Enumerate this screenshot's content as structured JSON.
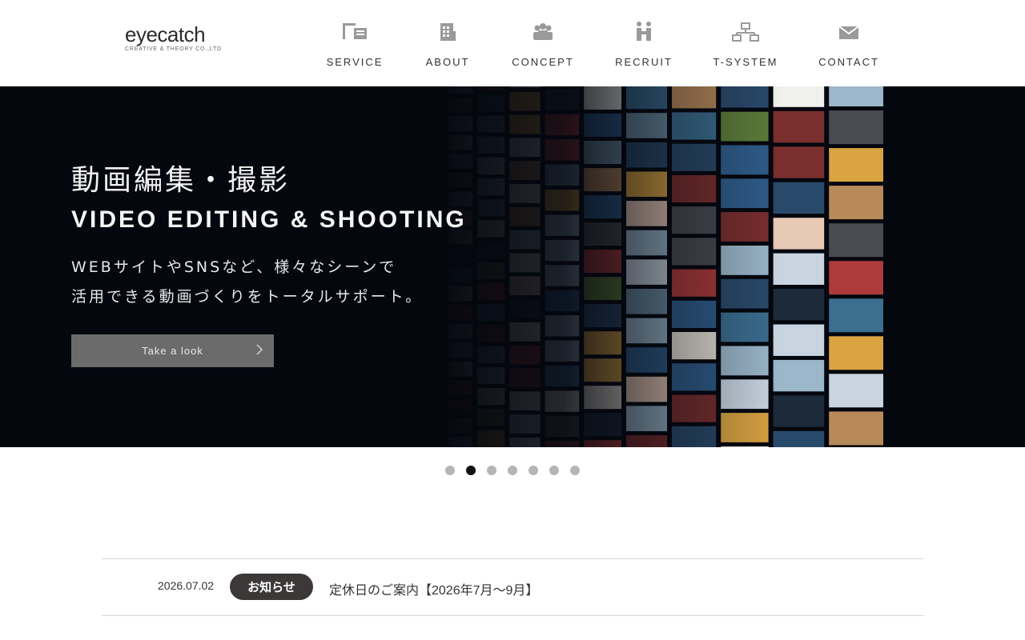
{
  "header": {
    "logo": {
      "main": "eyecatch",
      "sub": "CREATIVE & THEORY CO.,LTD"
    },
    "nav": [
      {
        "label": "SERVICE",
        "icon": "desk-icon"
      },
      {
        "label": "ABOUT",
        "icon": "building-icon"
      },
      {
        "label": "CONCEPT",
        "icon": "people-icon"
      },
      {
        "label": "RECRUIT",
        "icon": "handshake-icon"
      },
      {
        "label": "T-SYSTEM",
        "icon": "network-icon"
      },
      {
        "label": "CONTACT",
        "icon": "mail-icon"
      }
    ]
  },
  "hero": {
    "title_jp": "動画編集・撮影",
    "title_en": "VIDEO EDITING & SHOOTING",
    "desc_line1": "WEBサイトやSNSなど、様々なシーンで",
    "desc_line2": "活用できる動画づくりをトータルサポート。",
    "button_label": "Take a look",
    "background": "video-wall-image"
  },
  "carousel": {
    "count": 7,
    "active_index": 1
  },
  "news": {
    "date": "2026.07.02",
    "badge": "お知らせ",
    "title": "定休日のご案内【2026年7月〜9月】"
  },
  "colors": {
    "hero_bg": "#05070f",
    "button_bg": "#6b6b6b",
    "badge_bg": "#3c3838",
    "dot_active": "#111111",
    "dot_inactive": "#b5b5b5",
    "icon_gray": "#9a9a9a"
  }
}
